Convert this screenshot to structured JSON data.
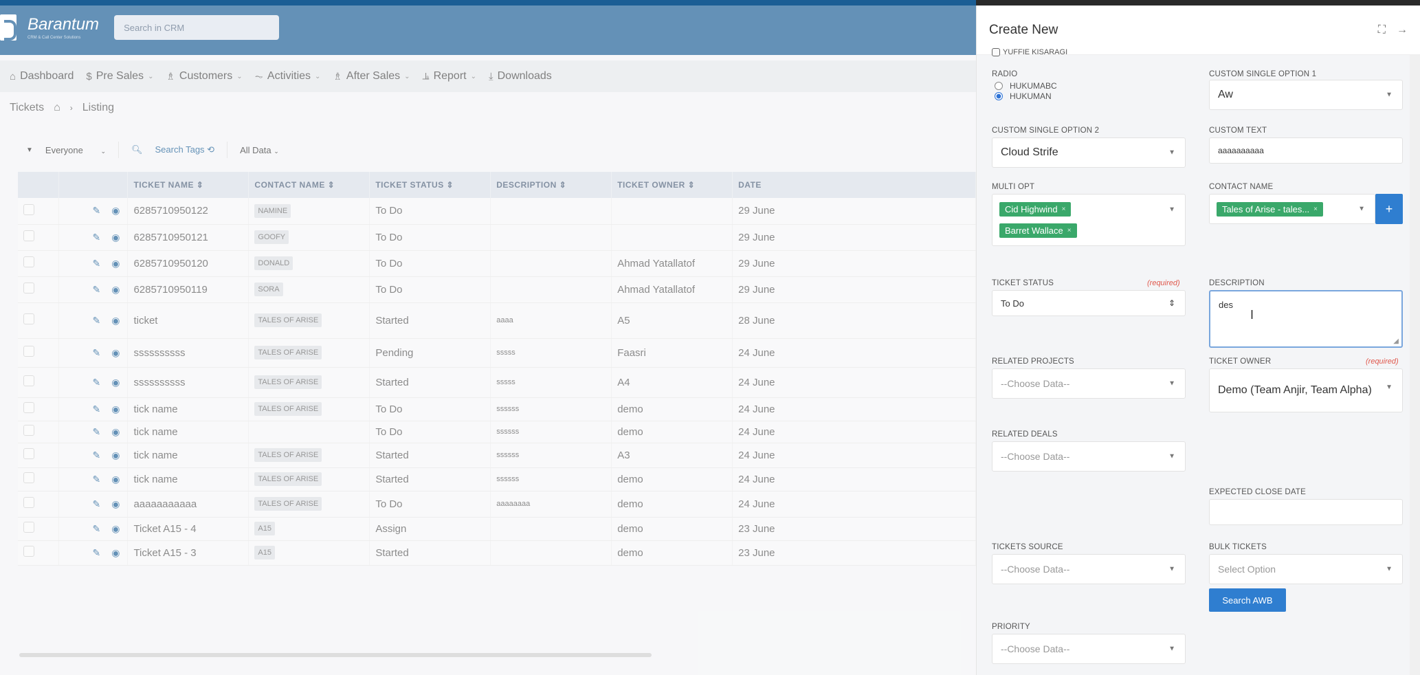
{
  "app": {
    "name": "Barantum",
    "tagline": "CRM & Call Center Solutions",
    "search_placeholder": "Search in CRM"
  },
  "nav": [
    {
      "label": "Dashboard",
      "icon": "home-icon",
      "has_caret": false
    },
    {
      "label": "Pre Sales",
      "icon": "dollar-icon",
      "has_caret": true
    },
    {
      "label": "Customers",
      "icon": "users-icon",
      "has_caret": true
    },
    {
      "label": "Activities",
      "icon": "pulse-icon",
      "has_caret": true
    },
    {
      "label": "After Sales",
      "icon": "users-icon",
      "has_caret": true
    },
    {
      "label": "Report",
      "icon": "chart-icon",
      "has_caret": true
    },
    {
      "label": "Downloads",
      "icon": "download-icon",
      "has_caret": false
    }
  ],
  "breadcrumb": {
    "section": "Tickets",
    "page": "Listing"
  },
  "filterbar": {
    "owner": "Everyone",
    "search_tags": "Search Tags",
    "all_data": "All Data"
  },
  "table": {
    "columns": [
      "TICKET NAME ⇕",
      "CONTACT NAME ⇕",
      "TICKET STATUS ⇕",
      "DESCRIPTION ⇕",
      "TICKET OWNER ⇕",
      "DATE"
    ],
    "rows": [
      {
        "name": "6285710950122",
        "contact": "NAMINE",
        "status": "To Do",
        "description": "",
        "owner": "",
        "date": "29 June"
      },
      {
        "name": "6285710950121",
        "contact": "GOOFY",
        "status": "To Do",
        "description": "",
        "owner": "",
        "date": "29 June"
      },
      {
        "name": "6285710950120",
        "contact": "DONALD",
        "status": "To Do",
        "description": "",
        "owner": "Ahmad Yatallatof",
        "date": "29 June"
      },
      {
        "name": "6285710950119",
        "contact": "SORA",
        "status": "To Do",
        "description": "",
        "owner": "Ahmad Yatallatof",
        "date": "29 June"
      },
      {
        "name": "ticket",
        "contact": "TALES OF ARISE",
        "status": "Started",
        "description": "aaaa",
        "owner": "A5",
        "date": "28 June"
      },
      {
        "name": "ssssssssss",
        "contact": "TALES OF ARISE",
        "status": "Pending",
        "description": "sssss",
        "owner": "Faasri",
        "date": "24 June"
      },
      {
        "name": "ssssssssss",
        "contact": "TALES OF ARISE",
        "status": "Started",
        "description": "sssss",
        "owner": "A4",
        "date": "24 June"
      },
      {
        "name": "tick name",
        "contact": "TALES OF ARISE",
        "status": "To Do",
        "description": "ssssss",
        "owner": "demo",
        "date": "24 June"
      },
      {
        "name": "tick name",
        "contact": "",
        "status": "To Do",
        "description": "ssssss",
        "owner": "demo",
        "date": "24 June"
      },
      {
        "name": "tick name",
        "contact": "TALES OF ARISE",
        "status": "Started",
        "description": "ssssss",
        "owner": "A3",
        "date": "24 June"
      },
      {
        "name": "tick name",
        "contact": "TALES OF ARISE",
        "status": "Started",
        "description": "ssssss",
        "owner": "demo",
        "date": "24 June"
      },
      {
        "name": "aaaaaaaaaaa",
        "contact": "TALES OF ARISE",
        "status": "To Do",
        "description": "aaaaaaaa",
        "owner": "demo",
        "date": "24 June"
      },
      {
        "name": "Ticket A15 - 4",
        "contact": "A15",
        "status": "Assign",
        "description": "",
        "owner": "demo",
        "date": "23 June"
      },
      {
        "name": "Ticket A15 - 3",
        "contact": "A15",
        "status": "Started",
        "description": "",
        "owner": "demo",
        "date": "23 June"
      }
    ]
  },
  "panel": {
    "title": "Create New",
    "checkbox_label": "YUFFIE KISARAGI",
    "radio": {
      "label": "RADIO",
      "options": [
        "HUKUMABC",
        "HUKUMAN"
      ],
      "selected": "HUKUMAN"
    },
    "custom_single_option_1": {
      "label": "CUSTOM SINGLE OPTION 1",
      "value": "Aw"
    },
    "custom_single_option_2": {
      "label": "CUSTOM SINGLE OPTION 2",
      "value": "Cloud Strife"
    },
    "custom_text": {
      "label": "CUSTOM TEXT",
      "value": "aaaaaaaaaa"
    },
    "multi_opt": {
      "label": "MULTI OPT",
      "values": [
        "Cid Highwind",
        "Barret Wallace"
      ]
    },
    "contact_name": {
      "label": "CONTACT NAME",
      "value": "Tales of Arise - tales..."
    },
    "ticket_status": {
      "label": "TICKET STATUS",
      "required": "(required)",
      "value": "To Do"
    },
    "description": {
      "label": "DESCRIPTION",
      "value": "des"
    },
    "related_projects": {
      "label": "RELATED PROJECTS",
      "placeholder": "--Choose Data--"
    },
    "ticket_owner": {
      "label": "TICKET OWNER",
      "required": "(required)",
      "value": "Demo (Team Anjir, Team Alpha)"
    },
    "related_deals": {
      "label": "RELATED DEALS",
      "placeholder": "--Choose Data--"
    },
    "expected_close_date": {
      "label": "EXPECTED CLOSE DATE",
      "value": ""
    },
    "tickets_source": {
      "label": "TICKETS SOURCE",
      "placeholder": "--Choose Data--"
    },
    "bulk_tickets": {
      "label": "BULK TICKETS",
      "placeholder": "Select Option"
    },
    "search_awb": "Search AWB",
    "priority": {
      "label": "PRIORITY",
      "placeholder": "--Choose Data--"
    }
  }
}
